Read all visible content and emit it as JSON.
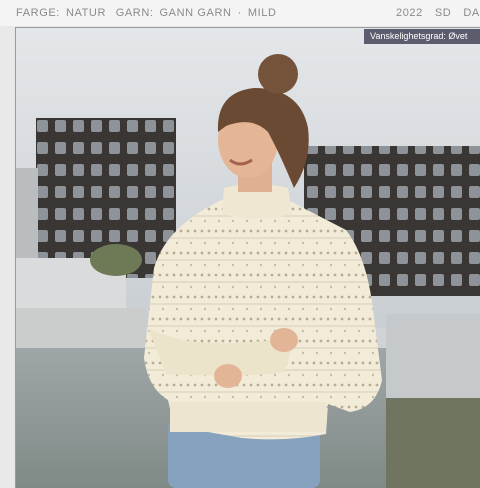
{
  "header": {
    "farge_label": "FARGE:",
    "farge_value": "NATUR",
    "garn_label": "GARN:",
    "garn_value": "GANN GARN",
    "separator": "·",
    "garn_type": "MILD",
    "year": "2022",
    "size_1": "SD",
    "size_2": "DAM"
  },
  "badge": {
    "text": "Vanskelighetsgrad: Øvet"
  },
  "photo": {
    "subject": "woman-in-cream-lace-knit-sweater"
  },
  "colors": {
    "badge_bg": "#5b5c6e",
    "sweater": "#f1ead6",
    "header_text": "#8a8a8a"
  }
}
